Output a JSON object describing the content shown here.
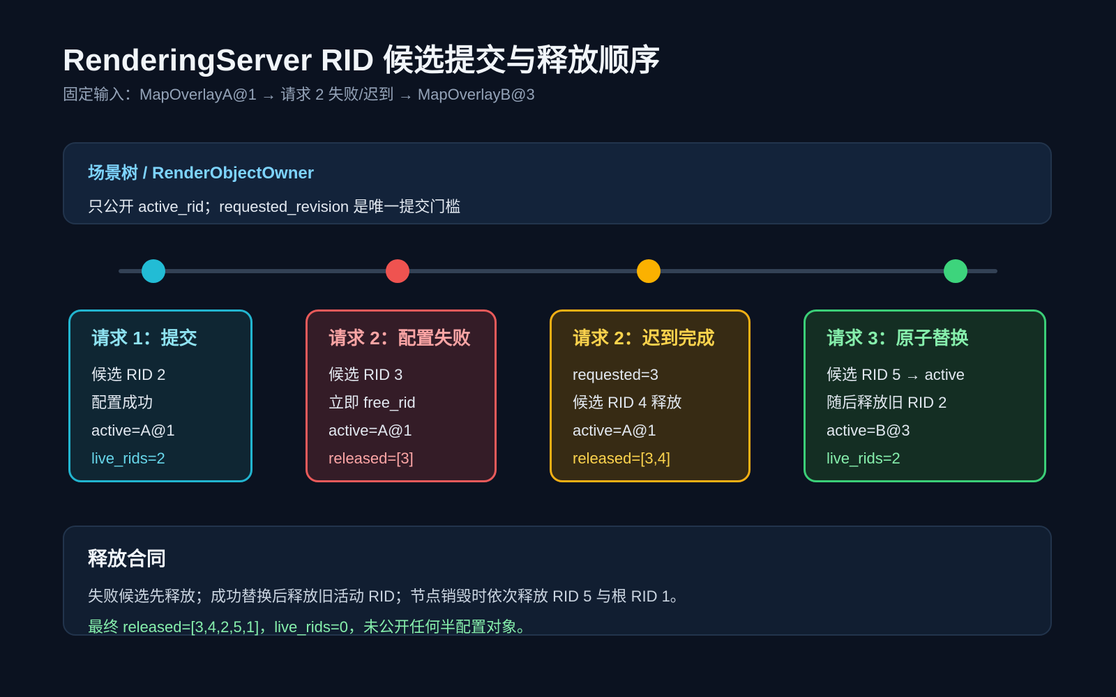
{
  "header": {
    "title": "RenderingServer RID 候选提交与释放顺序",
    "subtitle": "固定输入：MapOverlayA@1 → 请求 2 失败/迟到 → MapOverlayB@3"
  },
  "owner": {
    "heading": "场景树 / RenderObjectOwner",
    "description": "只公开 active_rid；requested_revision 是唯一提交门槛"
  },
  "timeline": {
    "dot_colors": [
      "#22bcd5",
      "#ef5350",
      "#fbb100",
      "#3dd47c"
    ]
  },
  "cards": [
    {
      "title": "请求 1：提交",
      "lines": [
        "候选 RID 2",
        "配置成功",
        "active=A@1",
        "live_rids=2"
      ],
      "border_color": "#22b5d0",
      "bg_color": "#0f2633",
      "title_color": "#8fe3f2",
      "accent_color": "#67d6ea"
    },
    {
      "title": "请求 2：配置失败",
      "lines": [
        "候选 RID 3",
        "立即 free_rid",
        "active=A@1",
        "released=[3]"
      ],
      "border_color": "#ea5a5a",
      "bg_color": "#341c27",
      "title_color": "#fca5a5",
      "accent_color": "#fca5a5"
    },
    {
      "title": "请求 2：迟到完成",
      "lines": [
        "requested=3",
        "候选 RID 4 释放",
        "active=A@1",
        "released=[3,4]"
      ],
      "border_color": "#f5b014",
      "bg_color": "#372b14",
      "title_color": "#fcd34d",
      "accent_color": "#fcd34d"
    },
    {
      "title": "请求 3：原子替换",
      "lines": [
        "候选 RID 5 → active",
        "随后释放旧 RID 2",
        "active=B@3",
        "live_rids=2"
      ],
      "border_color": "#3bcf78",
      "bg_color": "#142e23",
      "title_color": "#86efac",
      "accent_color": "#86efac"
    }
  ],
  "contract": {
    "heading": "释放合同",
    "line": "失败候选先释放；成功替换后释放旧活动 RID；节点销毁时依次释放 RID 5 与根 RID 1。",
    "final": "最终 released=[3,4,2,5,1]，live_rids=0，未公开任何半配置对象。"
  }
}
